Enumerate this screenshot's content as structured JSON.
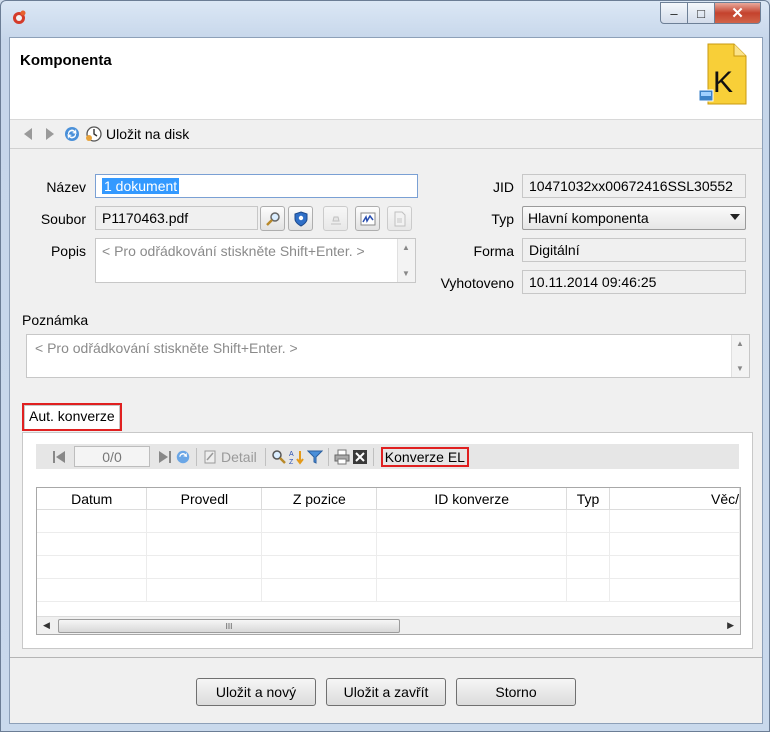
{
  "window": {
    "minimize_glyph": "‒",
    "maximize_glyph": "□",
    "close_glyph": "✕"
  },
  "header": {
    "title": "Komponenta",
    "doc_icon_letter": "K"
  },
  "toolbar": {
    "save_label": "Uložit na disk"
  },
  "form": {
    "name_label": "Název",
    "name_value": "1 dokument",
    "file_label": "Soubor",
    "file_value": "P1170463.pdf",
    "desc_label": "Popis",
    "desc_placeholder": "< Pro odřádkování stiskněte Shift+Enter. >",
    "jid_label": "JID",
    "jid_value": "10471032xx00672416SSL30552",
    "type_label": "Typ",
    "type_value": "Hlavní komponenta",
    "form_label": "Forma",
    "form_value": "Digitální",
    "created_label": "Vyhotoveno",
    "created_value": "10.11.2014 09:46:25",
    "note_label": "Poznámka",
    "note_placeholder": "< Pro odřádkování stiskněte Shift+Enter. >"
  },
  "tab": {
    "label": "Aut. konverze"
  },
  "gridbar": {
    "pager": "0/0",
    "detail_label": "Detail",
    "konverze_label": "Konverze EL"
  },
  "grid": {
    "columns": [
      "Datum",
      "Provedl",
      "Z pozice",
      "ID konverze",
      "Typ",
      "Věc/"
    ],
    "scroll_grip": "III"
  },
  "buttons": {
    "save_new": "Uložit a nový",
    "save_close": "Uložit a zavřít",
    "cancel": "Storno"
  },
  "colors": {
    "selection": "#3399ff",
    "highlight_box": "#e02020",
    "close_button": "#c4422d"
  }
}
